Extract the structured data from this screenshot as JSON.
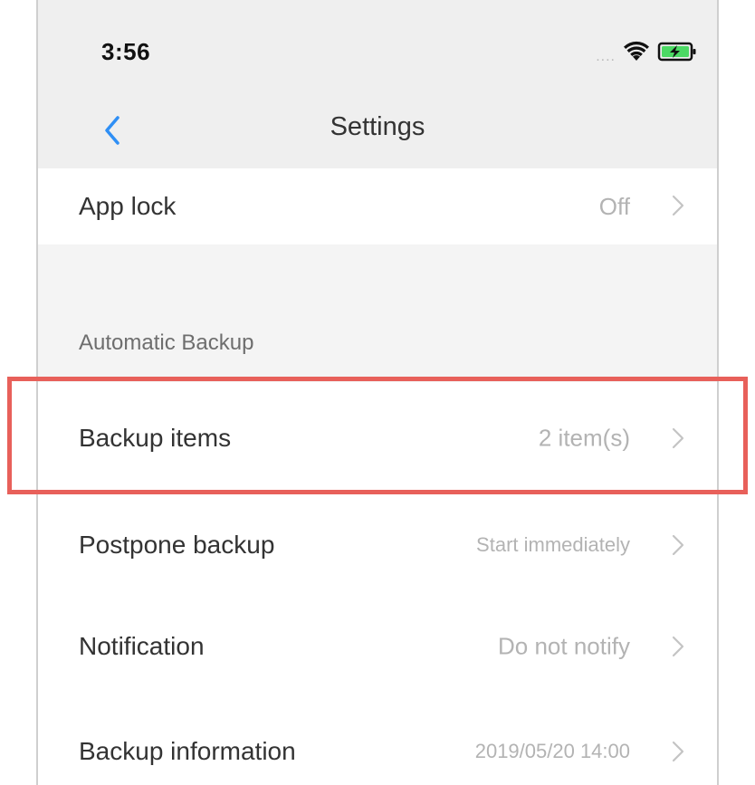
{
  "status_bar": {
    "time": "3:56",
    "signal_dots": "....",
    "icons": [
      "wifi-icon",
      "battery-charging-icon"
    ],
    "battery_color": "#4cd964"
  },
  "nav": {
    "title": "Settings",
    "back_icon": "chevron-left-icon",
    "accent": "#2f8ff5"
  },
  "rows": {
    "app_lock": {
      "label": "App lock",
      "value": "Off"
    },
    "backup_items": {
      "label": "Backup items",
      "value": "2 item(s)"
    },
    "postpone_backup": {
      "label": "Postpone backup",
      "value": "Start immediately"
    },
    "notification": {
      "label": "Notification",
      "value": "Do not notify"
    },
    "backup_information": {
      "label": "Backup information",
      "value": "2019/05/20 14:00"
    }
  },
  "sections": {
    "automatic_backup": "Automatic Backup"
  },
  "highlight_color": "#e8605a"
}
